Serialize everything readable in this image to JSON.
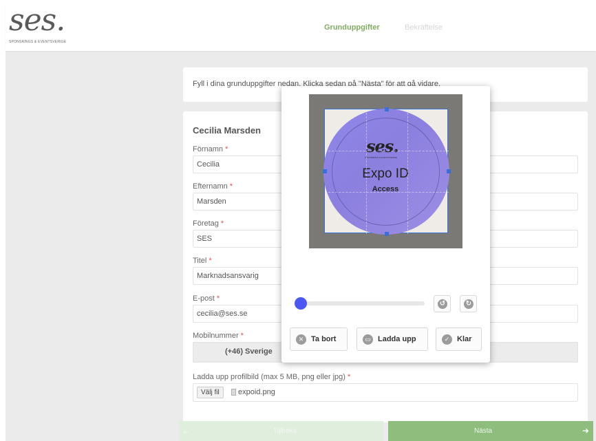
{
  "header": {
    "logo_text": "ses.",
    "logo_subtitle": "SPONSRINGS & EVENTSVERIGE",
    "steps": [
      {
        "label": "Grunduppgifter"
      },
      {
        "label": "Bekräftelse"
      }
    ]
  },
  "intro": {
    "text": "Fyll i dina grunduppgifter nedan. Klicka sedan på \"Nästa\" för att gå vidare."
  },
  "form": {
    "person_name": "Cecilia Marsden",
    "required_mark": "*",
    "fields": {
      "first_name": {
        "label": "Förnamn",
        "value": "Cecilia"
      },
      "last_name": {
        "label": "Efternamn",
        "value": "Marsden"
      },
      "company": {
        "label": "Företag",
        "value": "SES"
      },
      "title": {
        "label": "Titel",
        "value": "Marknadsansvarig"
      },
      "email": {
        "label": "E-post",
        "value": "cecilia@ses.se"
      },
      "mobile": {
        "label": "Mobilnummer",
        "prefix": "(+46) Sverige",
        "value": ""
      },
      "picture": {
        "label": "Ladda upp profilbild (max 5 MB, png eller jpg)",
        "button_label": "Välj fil",
        "file_name": "expoid.png"
      }
    }
  },
  "navigation": {
    "back_label": "Tillbaka",
    "next_label": "Nästa"
  },
  "cropper": {
    "image": {
      "logo": "ses.",
      "logo_subtitle": "SPONSRINGS & EVENTSVERIGE",
      "title": "Expo ID",
      "subtitle": "Access"
    },
    "zoom_level": 0,
    "rotate_left_icon": "rotate-ccw-icon",
    "rotate_right_icon": "rotate-cw-icon",
    "buttons": {
      "remove": "Ta bort",
      "upload": "Ladda upp",
      "done": "Klar"
    },
    "colors": {
      "accent": "#4b58ef",
      "crop_border": "#3b6fd8"
    }
  },
  "colors": {
    "brand_green": "#7fae61",
    "required_red": "#e05050"
  }
}
